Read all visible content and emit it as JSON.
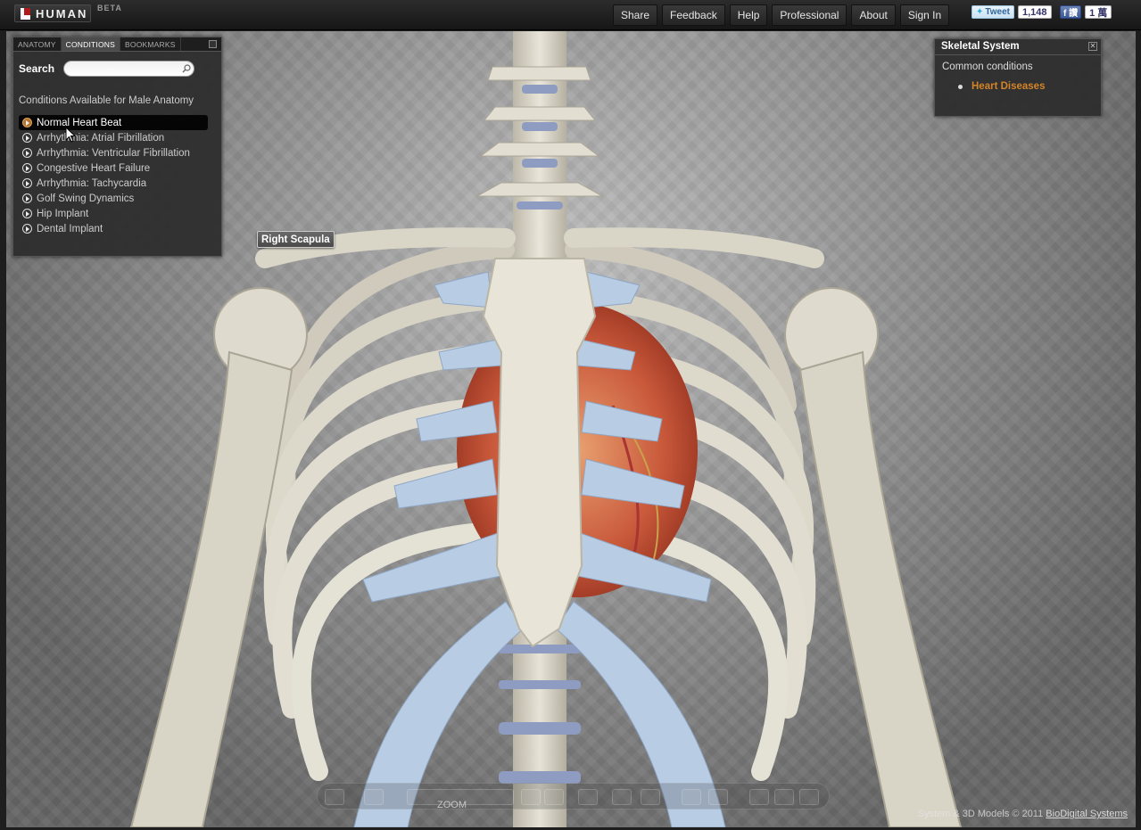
{
  "app": {
    "logo_text": "HUMAN",
    "beta_label": "BETA"
  },
  "nav": {
    "share": "Share",
    "feedback": "Feedback",
    "help": "Help",
    "professional": "Professional",
    "about": "About",
    "sign_in": "Sign In"
  },
  "social": {
    "tweet_label": "Tweet",
    "tweet_count": "1,148",
    "fb_label": "f 讚",
    "fb_count": "1 萬"
  },
  "left_panel": {
    "tabs": [
      "ANATOMY",
      "CONDITIONS",
      "BOOKMARKS"
    ],
    "active_tab": "CONDITIONS",
    "search_label": "Search",
    "search_value": "",
    "heading": "Conditions Available for Male Anatomy",
    "conditions": [
      "Normal Heart Beat",
      "Arrhythmia: Atrial Fibrillation",
      "Arrhythmia: Ventricular Fibrillation",
      "Congestive Heart Failure",
      "Arrhythmia: Tachycardia",
      "Golf Swing Dynamics",
      "Hip Implant",
      "Dental Implant"
    ],
    "selected_condition": "Normal Heart Beat"
  },
  "info_panel": {
    "title": "Skeletal System",
    "subtitle": "Common conditions",
    "link": "Heart Diseases",
    "link_color": "#d38428"
  },
  "viewport": {
    "structure_label": "Right Scapula",
    "zoom_label": "ZOOM",
    "copyright_text": "System & 3D Models © 2011",
    "copyright_link": "BioDigital Systems"
  }
}
